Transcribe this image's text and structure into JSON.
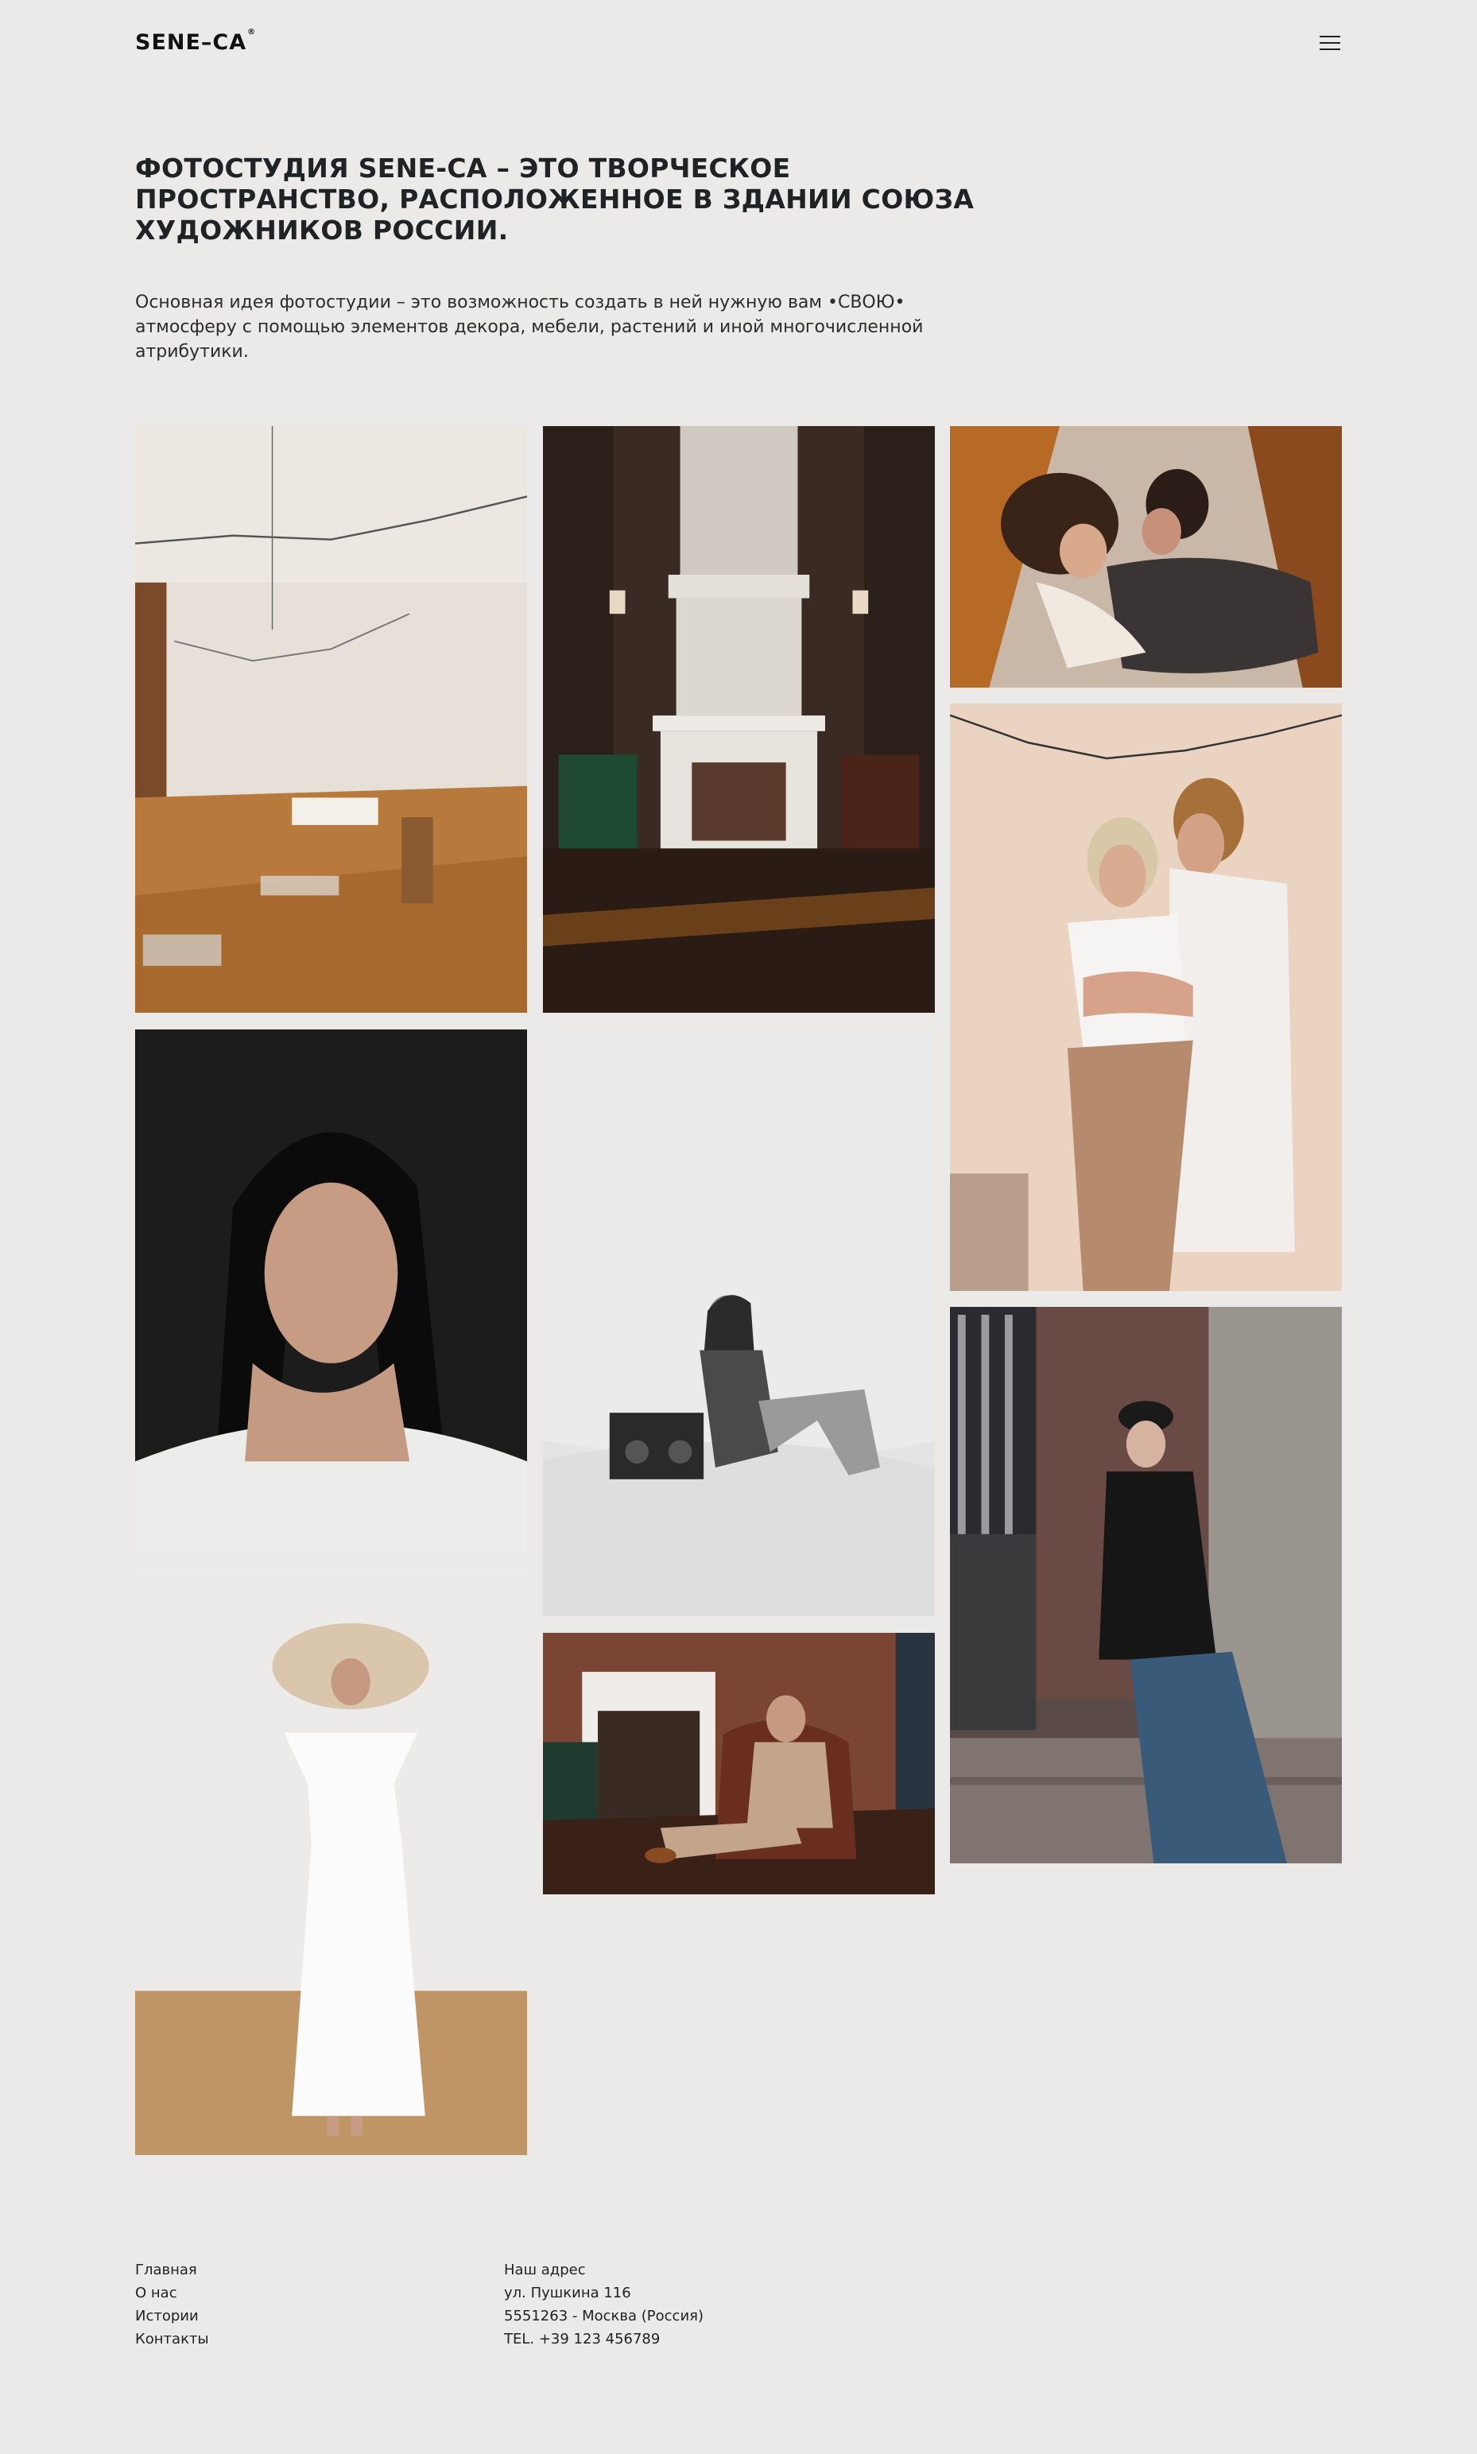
{
  "header": {
    "logo": "SENE–CA",
    "logo_mark": "®",
    "menu_icon": "hamburger-icon"
  },
  "hero": {
    "title": "ФОТОСТУДИЯ SENE-CA – ЭТО ТВОРЧЕСКОЕ ПРОСТРАНСТВО, РАСПОЛОЖЕННОЕ В ЗДАНИИ СОЮЗА ХУДОЖНИКОВ РОССИИ.",
    "text": "Основная идея фотостудии – это возможность создать в ней нужную вам •СВОЮ• атмосферу с помощью элементов декора, мебели, растений и иной многочисленной атрибутики."
  },
  "gallery": {
    "photos": [
      {
        "name": "studio-room-photo",
        "theme": "warm-interior"
      },
      {
        "name": "fireplace-room-photo",
        "theme": "dark-interior"
      },
      {
        "name": "couple-lying-photo",
        "theme": "warm-couple"
      },
      {
        "name": "couple-embrace-photo",
        "theme": "peach-couple"
      },
      {
        "name": "man-portrait-photo",
        "theme": "dark-portrait"
      },
      {
        "name": "woman-boombox-photo",
        "theme": "monochrome"
      },
      {
        "name": "woman-street-photo",
        "theme": "street"
      },
      {
        "name": "woman-white-dress-photo",
        "theme": "light-portrait"
      },
      {
        "name": "man-armchair-photo",
        "theme": "brown-interior"
      }
    ]
  },
  "footer": {
    "nav": [
      "Главная",
      "О нас",
      "Истории",
      "Контакты"
    ],
    "address": [
      "Наш адрес",
      "ул. Пушкина 116",
      "5551263 - Москва (Россия)",
      "TEL. +39 123 456789"
    ]
  },
  "colors": {
    "background": "#ebeae8",
    "text": "#222426"
  }
}
